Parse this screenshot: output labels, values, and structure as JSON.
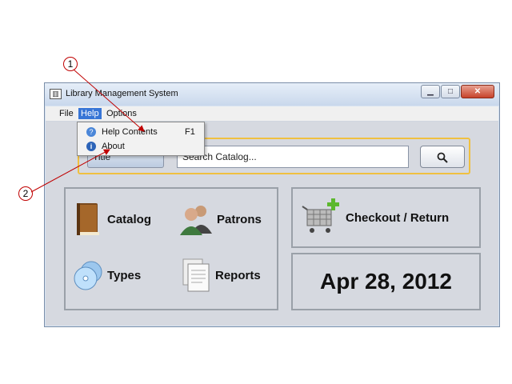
{
  "window": {
    "title": "Library Management System"
  },
  "menubar": {
    "items": [
      "File",
      "Help",
      "Options"
    ]
  },
  "help_menu": {
    "items": [
      {
        "label": "Help Contents",
        "accelerator": "F1",
        "icon": "question-icon"
      },
      {
        "label": "About",
        "accelerator": "",
        "icon": "info-icon"
      }
    ]
  },
  "search": {
    "combo_value": "Title",
    "placeholder": "Search Catalog...",
    "button_icon": "search-icon"
  },
  "tiles": {
    "catalog": "Catalog",
    "patrons": "Patrons",
    "types": "Types",
    "reports": "Reports",
    "checkout": "Checkout / Return"
  },
  "date": "Apr 28, 2012",
  "callouts": [
    "1",
    "2"
  ]
}
